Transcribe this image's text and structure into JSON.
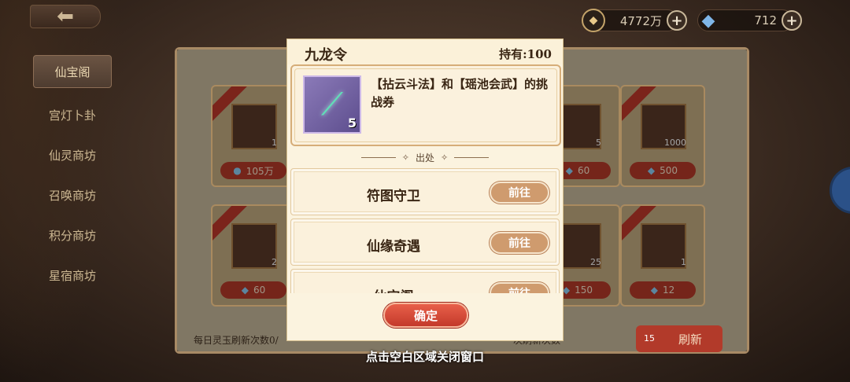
{
  "top_bar": {
    "gold_amount": "4772万",
    "jade_amount": "712",
    "plus_symbol": "+"
  },
  "side_nav": {
    "items": [
      {
        "label": "仙宝阁"
      },
      {
        "label": "宫灯卜卦"
      },
      {
        "label": "仙灵商坊"
      },
      {
        "label": "召唤商坊"
      },
      {
        "label": "积分商坊"
      },
      {
        "label": "星宿商坊"
      }
    ]
  },
  "shop_cards": [
    {
      "item_count": "1",
      "price": "105万"
    },
    {
      "item_count": "5",
      "price": "60"
    },
    {
      "item_count": "1000",
      "price": "500"
    },
    {
      "item_count": "2",
      "price": "60"
    },
    {
      "item_count": "25",
      "price": "150"
    },
    {
      "item_count": "1",
      "price": "12"
    }
  ],
  "bottom": {
    "daily_refresh_text": "每日灵玉刷新次数0/",
    "next_refresh_text": "一次刷新次数",
    "refresh_cost": "15",
    "refresh_label": "刷新"
  },
  "popup": {
    "title": "九龙令",
    "hold_label": "持有:100",
    "item_qty": "5",
    "description": "【拈云斗法】和【瑶池会武】的挑战券",
    "source_label": "出处",
    "sources": [
      {
        "name": "符图守卫",
        "button": "前往"
      },
      {
        "name": "仙缘奇遇",
        "button": "前往"
      },
      {
        "name": "仙宝阁",
        "button": "前往"
      }
    ],
    "confirm_label": "确定"
  },
  "close_hint": "点击空白区域关闭窗口",
  "colors": {
    "confirm": "#d44a36",
    "goto": "#cf9b6e",
    "item_frame": "#7a6aa8"
  }
}
